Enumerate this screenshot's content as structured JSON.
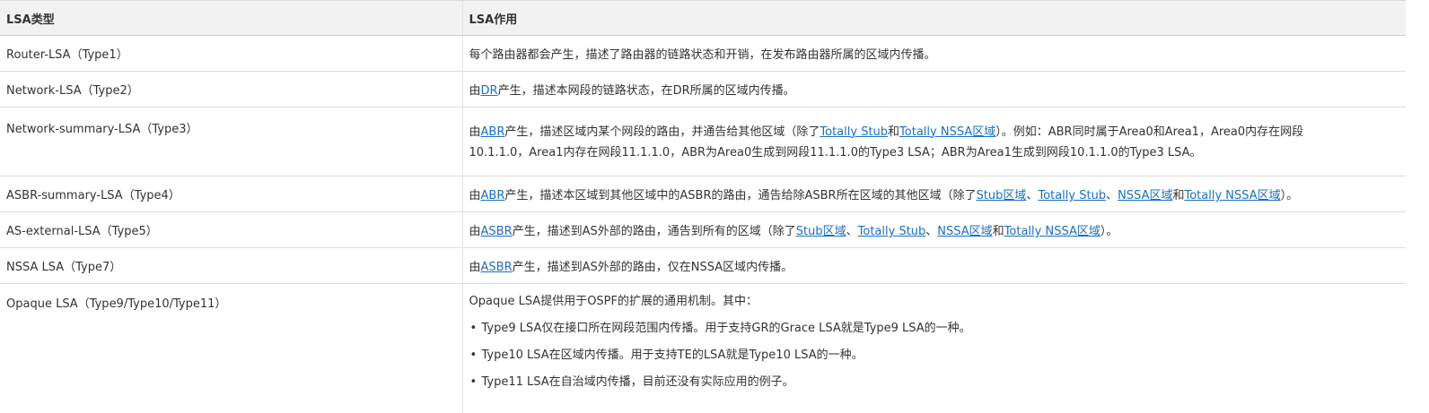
{
  "headers": {
    "type": "LSA类型",
    "desc": "LSA作用"
  },
  "rows": [
    {
      "type": "Router-LSA（Type1）",
      "lines": [
        [
          {
            "t": "每个路由器都会产生，描述了路由器的链路状态和开销，在发布路由器所属的区域内传播。"
          }
        ]
      ]
    },
    {
      "type": "Network-LSA（Type2）",
      "lines": [
        [
          {
            "t": "由"
          },
          {
            "t": "DR",
            "link": true
          },
          {
            "t": "产生，描述本网段的链路状态，在DR所属的区域内传播。"
          }
        ]
      ]
    },
    {
      "type": "Network-summary-LSA（Type3）",
      "lines": [
        [
          {
            "t": "由"
          },
          {
            "t": "ABR",
            "link": true
          },
          {
            "t": "产生，描述区域内某个网段的路由，并通告给其他区域（除了"
          },
          {
            "t": "Totally Stub",
            "link": true
          },
          {
            "t": "和"
          },
          {
            "t": "Totally NSSA区域",
            "link": true
          },
          {
            "t": "）。例如：ABR同时属于Area0和Area1，Area0内存在网段"
          }
        ],
        [
          {
            "t": "10.1.1.0，Area1内存在网段11.1.1.0，ABR为Area0生成到网段11.1.1.0的Type3 LSA；ABR为Area1生成到网段10.1.1.0的Type3 LSA。"
          }
        ]
      ]
    },
    {
      "type": "ASBR-summary-LSA（Type4）",
      "lines": [
        [
          {
            "t": "由"
          },
          {
            "t": "ABR",
            "link": true
          },
          {
            "t": "产生，描述本区域到其他区域中的ASBR的路由，通告给除ASBR所在区域的其他区域（除了"
          },
          {
            "t": "Stub区域",
            "link": true
          },
          {
            "t": "、"
          },
          {
            "t": "Totally Stub",
            "link": true
          },
          {
            "t": "、"
          },
          {
            "t": "NSSA区域",
            "link": true
          },
          {
            "t": "和"
          },
          {
            "t": "Totally NSSA区域",
            "link": true
          },
          {
            "t": "）。"
          }
        ]
      ]
    },
    {
      "type": "AS-external-LSA（Type5）",
      "lines": [
        [
          {
            "t": "由"
          },
          {
            "t": "ASBR",
            "link": true
          },
          {
            "t": "产生，描述到AS外部的路由，通告到所有的区域（除了"
          },
          {
            "t": "Stub区域",
            "link": true
          },
          {
            "t": "、"
          },
          {
            "t": "Totally Stub",
            "link": true
          },
          {
            "t": "、"
          },
          {
            "t": "NSSA区域",
            "link": true
          },
          {
            "t": "和"
          },
          {
            "t": "Totally NSSA区域",
            "link": true
          },
          {
            "t": "）。"
          }
        ]
      ]
    },
    {
      "type": "NSSA LSA（Type7）",
      "lines": [
        [
          {
            "t": "由"
          },
          {
            "t": "ASBR",
            "link": true
          },
          {
            "t": "产生，描述到AS外部的路由，仅在NSSA区域内传播。"
          }
        ]
      ]
    }
  ],
  "opaque": {
    "type": "Opaque LSA（Type9/Type10/Type11）",
    "intro": "Opaque LSA提供用于OSPF的扩展的通用机制。其中：",
    "bullet_char": "•",
    "bullets": [
      "Type9 LSA仅在接口所在网段范围内传播。用于支持GR的Grace LSA就是Type9 LSA的一种。",
      "Type10 LSA在区域内传播。用于支持TE的LSA就是Type10 LSA的一种。",
      "Type11 LSA在自治域内传播，目前还没有实际应用的例子。"
    ]
  },
  "colors": {
    "link": "#1a6fc0",
    "header_bg": "#f2f2f2",
    "text": "#333333"
  }
}
